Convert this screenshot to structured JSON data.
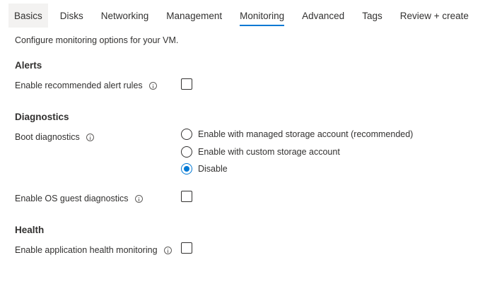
{
  "tabs": [
    {
      "label": "Basics"
    },
    {
      "label": "Disks"
    },
    {
      "label": "Networking"
    },
    {
      "label": "Management"
    },
    {
      "label": "Monitoring",
      "active": true
    },
    {
      "label": "Advanced"
    },
    {
      "label": "Tags"
    },
    {
      "label": "Review + create"
    }
  ],
  "description": "Configure monitoring options for your VM.",
  "alerts": {
    "title": "Alerts",
    "recommended_rules_label": "Enable recommended alert rules",
    "recommended_rules_checked": false
  },
  "diagnostics": {
    "title": "Diagnostics",
    "boot_label": "Boot diagnostics",
    "boot_options": [
      {
        "label": "Enable with managed storage account (recommended)",
        "selected": false
      },
      {
        "label": "Enable with custom storage account",
        "selected": false
      },
      {
        "label": "Disable",
        "selected": true
      }
    ],
    "os_guest_label": "Enable OS guest diagnostics",
    "os_guest_checked": false
  },
  "health": {
    "title": "Health",
    "app_health_label": "Enable application health monitoring",
    "app_health_checked": false
  },
  "colors": {
    "accent": "#0078d4",
    "text": "#323130",
    "tab_hover_bg": "#f3f2f1"
  }
}
